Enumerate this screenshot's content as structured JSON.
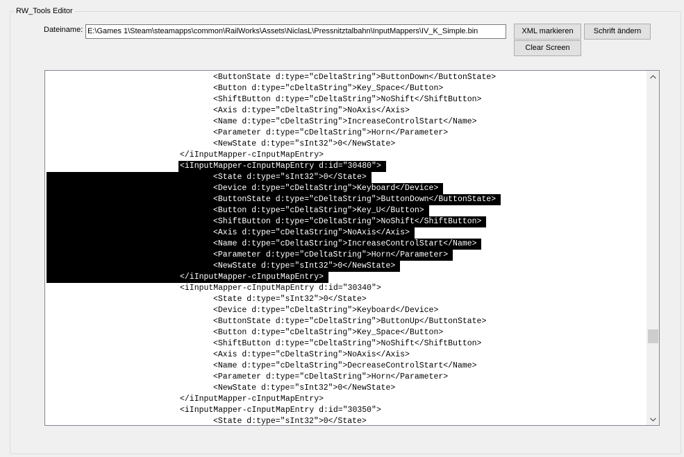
{
  "window": {
    "group_title": "RW_Tools Editor"
  },
  "form": {
    "filename_label": "Dateiname:",
    "filename_value": "E:\\Games 1\\Steam\\steamapps\\common\\RailWorks\\Assets\\NiclasL\\Pressnitztalbahn\\InputMappers\\IV_K_Simple.bin"
  },
  "buttons": {
    "xml_mark": "XML markieren",
    "change_font": "Schrift ändern",
    "clear_screen": "Clear Screen"
  },
  "scrollbar": {
    "up_icon": "chevron-up-icon",
    "down_icon": "chevron-down-icon",
    "position_fraction": 0.78
  },
  "editor": {
    "lines": [
      {
        "indent": 2,
        "text": "<ButtonState d:type=\"cDeltaString\">ButtonDown</ButtonState>"
      },
      {
        "indent": 2,
        "text": "<Button d:type=\"cDeltaString\">Key_Space</Button>"
      },
      {
        "indent": 2,
        "text": "<ShiftButton d:type=\"cDeltaString\">NoShift</ShiftButton>"
      },
      {
        "indent": 2,
        "text": "<Axis d:type=\"cDeltaString\">NoAxis</Axis>"
      },
      {
        "indent": 2,
        "text": "<Name d:type=\"cDeltaString\">IncreaseControlStart</Name>"
      },
      {
        "indent": 2,
        "text": "<Parameter d:type=\"cDeltaString\">Horn</Parameter>"
      },
      {
        "indent": 2,
        "text": "<NewState d:type=\"sInt32\">0</NewState>"
      },
      {
        "indent": 1,
        "text": "</iInputMapper-cInputMapEntry>"
      },
      {
        "indent": 1,
        "text": "<iInputMapper-cInputMapEntry d:id=\"30480\">",
        "hl": "text"
      },
      {
        "indent": 2,
        "text": "<State d:type=\"sInt32\">0</State>",
        "hl": "full"
      },
      {
        "indent": 2,
        "text": "<Device d:type=\"cDeltaString\">Keyboard</Device>",
        "hl": "full"
      },
      {
        "indent": 2,
        "text": "<ButtonState d:type=\"cDeltaString\">ButtonDown</ButtonState>",
        "hl": "full"
      },
      {
        "indent": 2,
        "text": "<Button d:type=\"cDeltaString\">Key_U</Button>",
        "hl": "full"
      },
      {
        "indent": 2,
        "text": "<ShiftButton d:type=\"cDeltaString\">NoShift</ShiftButton>",
        "hl": "full"
      },
      {
        "indent": 2,
        "text": "<Axis d:type=\"cDeltaString\">NoAxis</Axis>",
        "hl": "full"
      },
      {
        "indent": 2,
        "text": "<Name d:type=\"cDeltaString\">IncreaseControlStart</Name>",
        "hl": "full"
      },
      {
        "indent": 2,
        "text": "<Parameter d:type=\"cDeltaString\">Horn</Parameter>",
        "hl": "full"
      },
      {
        "indent": 2,
        "text": "<NewState d:type=\"sInt32\">0</NewState>",
        "hl": "full"
      },
      {
        "indent": 1,
        "text": "</iInputMapper-cInputMapEntry>",
        "hl": "full"
      },
      {
        "indent": 1,
        "text": "<iInputMapper-cInputMapEntry d:id=\"30340\">"
      },
      {
        "indent": 2,
        "text": "<State d:type=\"sInt32\">0</State>"
      },
      {
        "indent": 2,
        "text": "<Device d:type=\"cDeltaString\">Keyboard</Device>"
      },
      {
        "indent": 2,
        "text": "<ButtonState d:type=\"cDeltaString\">ButtonUp</ButtonState>"
      },
      {
        "indent": 2,
        "text": "<Button d:type=\"cDeltaString\">Key_Space</Button>"
      },
      {
        "indent": 2,
        "text": "<ShiftButton d:type=\"cDeltaString\">NoShift</ShiftButton>"
      },
      {
        "indent": 2,
        "text": "<Axis d:type=\"cDeltaString\">NoAxis</Axis>"
      },
      {
        "indent": 2,
        "text": "<Name d:type=\"cDeltaString\">DecreaseControlStart</Name>"
      },
      {
        "indent": 2,
        "text": "<Parameter d:type=\"cDeltaString\">Horn</Parameter>"
      },
      {
        "indent": 2,
        "text": "<NewState d:type=\"sInt32\">0</NewState>"
      },
      {
        "indent": 1,
        "text": "</iInputMapper-cInputMapEntry>"
      },
      {
        "indent": 1,
        "text": "<iInputMapper-cInputMapEntry d:id=\"30350\">"
      },
      {
        "indent": 2,
        "text": "<State d:type=\"sInt32\">0</State>"
      }
    ]
  }
}
